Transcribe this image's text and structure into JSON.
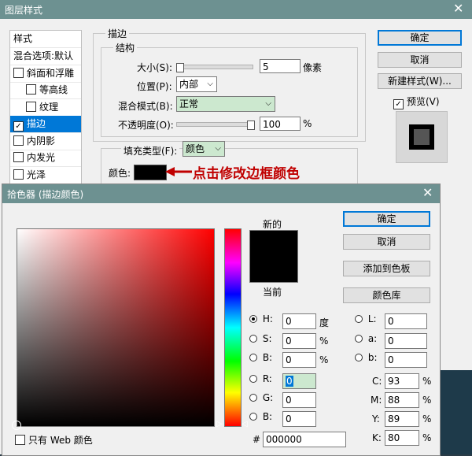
{
  "layer_style": {
    "title": "图层样式",
    "left_panel": {
      "header": "样式",
      "items": [
        {
          "label": "混合选项:默认",
          "checkbox": false,
          "checked": false,
          "selected": false,
          "indent": false
        },
        {
          "label": "斜面和浮雕",
          "checkbox": true,
          "checked": false,
          "selected": false,
          "indent": false
        },
        {
          "label": "等高线",
          "checkbox": true,
          "checked": false,
          "selected": false,
          "indent": true
        },
        {
          "label": "纹理",
          "checkbox": true,
          "checked": false,
          "selected": false,
          "indent": true
        },
        {
          "label": "描边",
          "checkbox": true,
          "checked": true,
          "selected": true,
          "indent": false
        },
        {
          "label": "内阴影",
          "checkbox": true,
          "checked": false,
          "selected": false,
          "indent": false
        },
        {
          "label": "内发光",
          "checkbox": true,
          "checked": false,
          "selected": false,
          "indent": false
        },
        {
          "label": "光泽",
          "checkbox": true,
          "checked": false,
          "selected": false,
          "indent": false
        }
      ]
    },
    "stroke": {
      "section_title": "描边",
      "structure_title": "结构",
      "size_label": "大小(S):",
      "size_value": "5",
      "size_unit": "像素",
      "position_label": "位置(P):",
      "position_value": "内部",
      "blend_label": "混合模式(B):",
      "blend_value": "正常",
      "opacity_label": "不透明度(O):",
      "opacity_value": "100",
      "opacity_unit": "%",
      "fill_type_label": "填充类型(F):",
      "fill_type_value": "颜色",
      "color_label": "颜色:",
      "color_value": "#000000",
      "annotation": "点击修改边框颜色"
    },
    "buttons": {
      "ok": "确定",
      "cancel": "取消",
      "new_style": "新建样式(W)...",
      "preview_label": "预览(V)",
      "preview_checked": true
    }
  },
  "color_picker": {
    "title": "拾色器 (描边颜色)",
    "new_label": "新的",
    "current_label": "当前",
    "new_color": "#000000",
    "current_color": "#000000",
    "buttons": {
      "ok": "确定",
      "cancel": "取消",
      "add_swatch": "添加到色板",
      "color_library": "颜色库"
    },
    "hsb": [
      {
        "label": "H:",
        "value": "0",
        "unit": "度",
        "selected": true
      },
      {
        "label": "S:",
        "value": "0",
        "unit": "%",
        "selected": false
      },
      {
        "label": "B:",
        "value": "0",
        "unit": "%",
        "selected": false
      }
    ],
    "rgb": [
      {
        "label": "R:",
        "value": "0",
        "selected": false
      },
      {
        "label": "G:",
        "value": "0",
        "selected": false
      },
      {
        "label": "B:",
        "value": "0",
        "selected": false
      }
    ],
    "lab": [
      {
        "label": "L:",
        "value": "0"
      },
      {
        "label": "a:",
        "value": "0"
      },
      {
        "label": "b:",
        "value": "0"
      }
    ],
    "cmyk": [
      {
        "label": "C:",
        "value": "93",
        "unit": "%"
      },
      {
        "label": "M:",
        "value": "88",
        "unit": "%"
      },
      {
        "label": "Y:",
        "value": "89",
        "unit": "%"
      },
      {
        "label": "K:",
        "value": "80",
        "unit": "%"
      }
    ],
    "hex_label": "#",
    "hex_value": "000000",
    "web_only_label": "只有 Web 颜色",
    "hue_fraction": 0.0
  }
}
